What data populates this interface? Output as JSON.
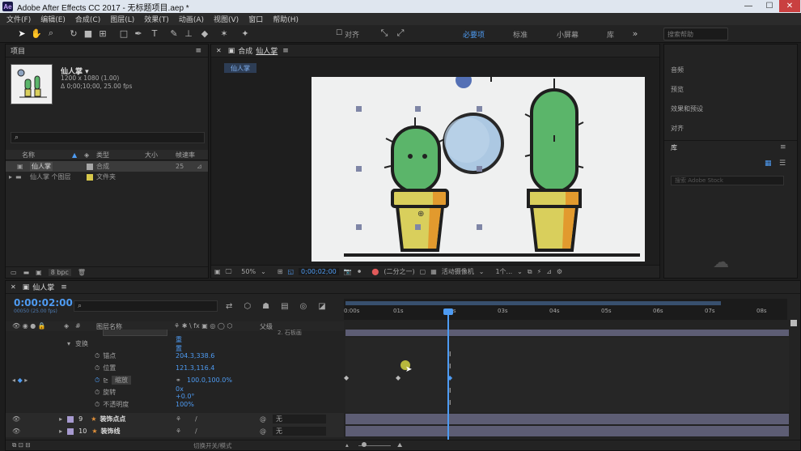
{
  "window": {
    "title": "Adobe After Effects CC 2017 - 无标题项目.aep *",
    "app_badge": "Ae"
  },
  "menu": [
    "文件(F)",
    "编辑(E)",
    "合成(C)",
    "图层(L)",
    "效果(T)",
    "动画(A)",
    "视图(V)",
    "窗口",
    "帮助(H)"
  ],
  "toolbar": {
    "snap_label": "对齐",
    "workspaces": [
      "必要项",
      "标准",
      "小屏幕",
      "库"
    ],
    "search_placeholder": "搜索帮助"
  },
  "project": {
    "title": "项目",
    "comp_name": "仙人掌 ▾",
    "comp_size": "1200 x 1080 (1.00)",
    "comp_duration": "Δ 0;00;10;00, 25.00 fps",
    "columns": [
      "名称",
      "类型",
      "大小",
      "帧速率"
    ],
    "items": [
      {
        "name": "仙人掌",
        "type": "合成",
        "fps": "25"
      },
      {
        "name": "仙人掌 个图层",
        "type": "文件夹",
        "fps": ""
      }
    ],
    "bpc": "8 bpc"
  },
  "composition": {
    "tab_label": "合成",
    "comp_tab": "仙人掌",
    "breadcrumb": "仙人掌",
    "zoom": "50%",
    "timecode": "0;00;02;00",
    "resolution": "(二分之一)",
    "camera": "活动摄像机",
    "views": "1个..."
  },
  "right_panel": {
    "items": [
      "音频",
      "预览",
      "效果和预设",
      "对齐"
    ],
    "library_title": "库",
    "library_search": "搜索 Adobe Stock"
  },
  "timeline": {
    "tab": "仙人掌",
    "timecode": "0:00:02:00",
    "fps_info": "00050 (25.00 fps)",
    "col_layer_name": "图层名称",
    "col_parent": "父级",
    "parent_peek": "2. 石板画",
    "ruler": [
      "0:00s",
      "01s",
      "02s",
      "03s",
      "04s",
      "05s",
      "06s",
      "07s",
      "08s"
    ],
    "transform_label": "变换",
    "reset_label": "重置",
    "properties": [
      {
        "name": "锚点",
        "value": "204.3,338.6"
      },
      {
        "name": "位置",
        "value": "121.3,116.4"
      },
      {
        "name": "缩放",
        "value": "100.0,100.0%"
      },
      {
        "name": "旋转",
        "value": "0x +0.0°"
      },
      {
        "name": "不透明度",
        "value": "100%"
      }
    ],
    "layers": [
      {
        "index": "9",
        "name": "装饰点点",
        "parent": "无"
      },
      {
        "index": "10",
        "name": "装饰线",
        "parent": "无"
      }
    ],
    "footer_label": "切换开关/模式"
  },
  "colors": {
    "accent": "#4e9bf2",
    "cactus": "#5bb56a",
    "pot_yellow": "#d9cf5c",
    "pot_orange": "#e29a2e",
    "bubble": "#a9c6e2"
  }
}
